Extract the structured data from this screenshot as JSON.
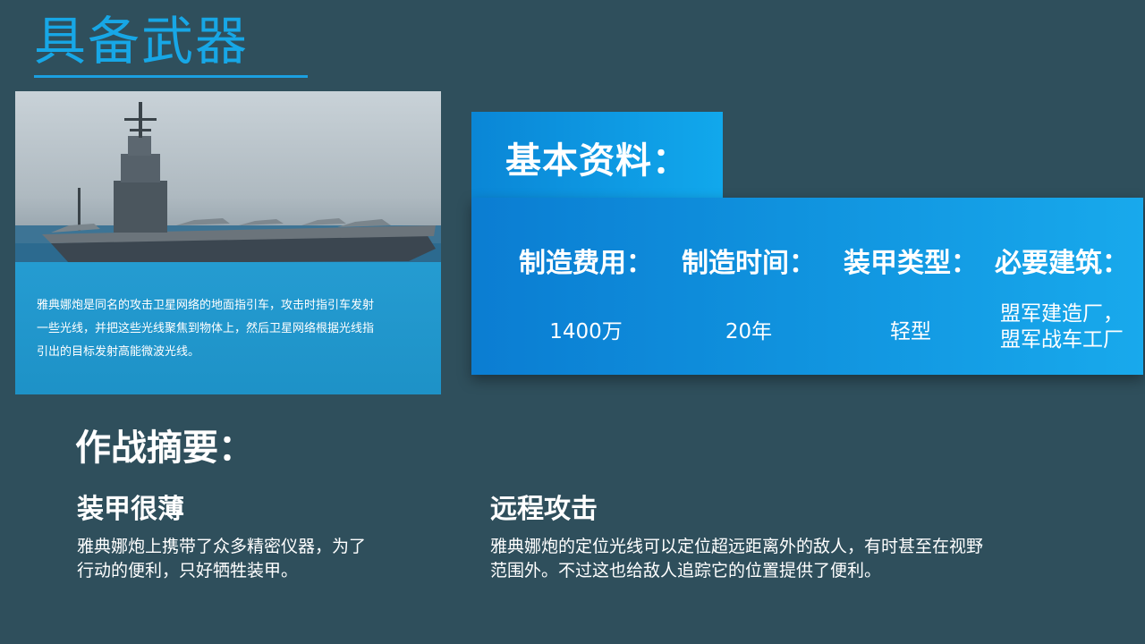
{
  "page": {
    "title": "具备武器"
  },
  "photo": {
    "caption": "雅典娜炮是同名的攻击卫星网络的地面指引车，攻击时指引车发射一些光线，并把这些光线聚焦到物体上，然后卫星网络根据光线指引出的目标发射高能微波光线。"
  },
  "info": {
    "heading": "基本资料：",
    "columns": [
      {
        "label": "制造费用：",
        "value": "1400万"
      },
      {
        "label": "制造时间：",
        "value": "20年"
      },
      {
        "label": "装甲类型：",
        "value": "轻型"
      },
      {
        "label": "必要建筑：",
        "value_line1": "盟军建造厂，",
        "value_line2": "盟军战车工厂"
      }
    ]
  },
  "summary": {
    "heading": "作战摘要：",
    "items": [
      {
        "title": "装甲很薄",
        "body_line1": "雅典娜炮上携带了众多精密仪器，为了",
        "body_line2": "行动的便利，只好牺牲装甲。"
      },
      {
        "title": "远程攻击",
        "body_line1": "雅典娜炮的定位光线可以定位超远距离外的敌人，有时甚至在视野",
        "body_line2": "范围外。不过这也给敌人追踪它的位置提供了便利。"
      }
    ]
  },
  "colors": {
    "background": "#2f4f5c",
    "accent": "#17a7e6",
    "card_blue": "#0b7dd2"
  }
}
